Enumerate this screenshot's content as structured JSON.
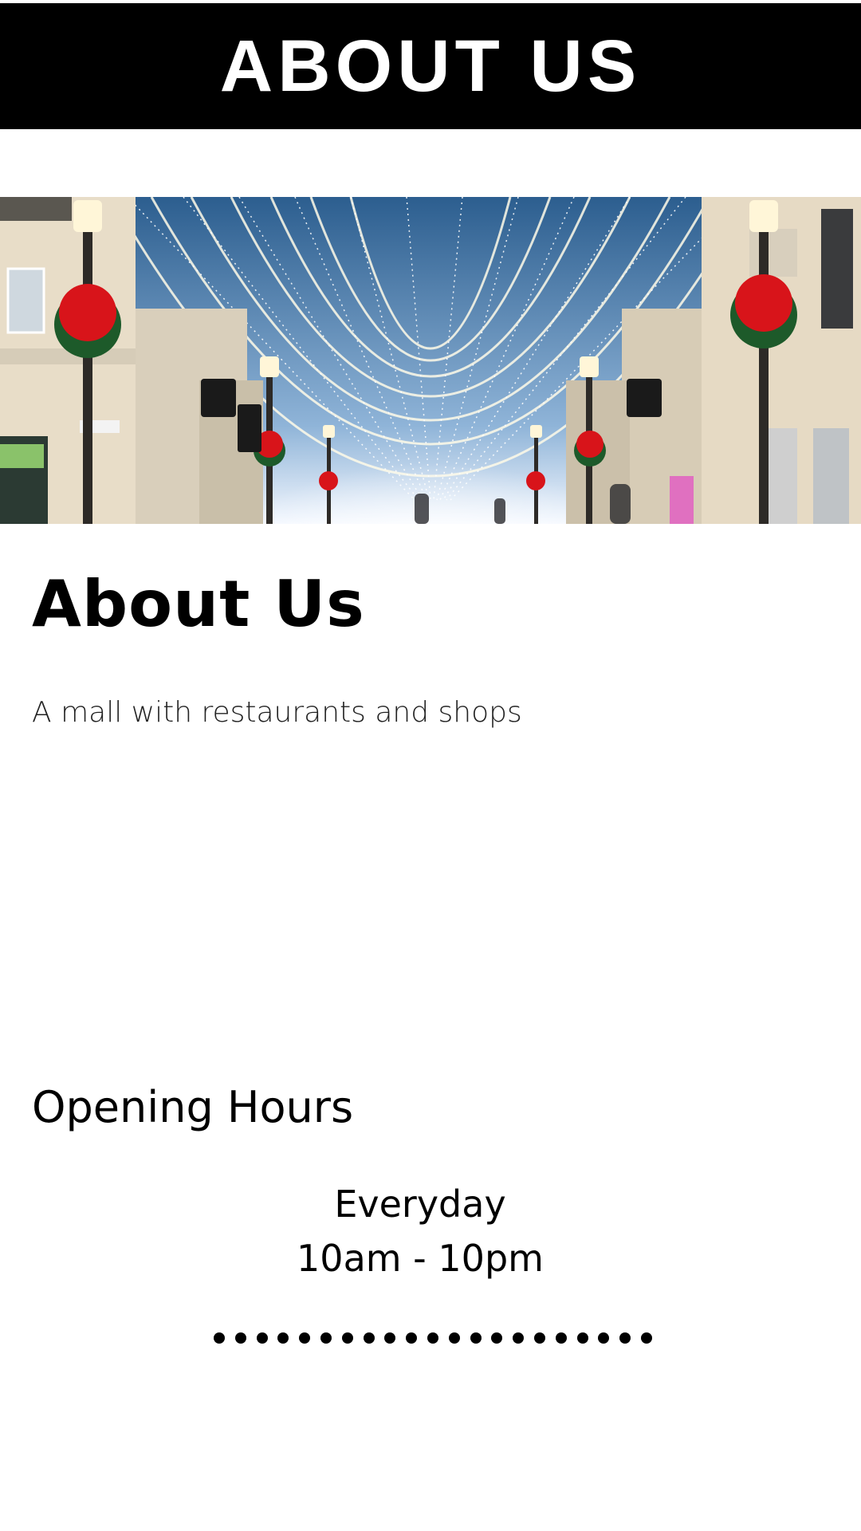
{
  "banner": {
    "title": "ABOUT US"
  },
  "hero": {
    "image": "christmas-lights-street-photo"
  },
  "main": {
    "heading": "About Us",
    "tagline": "A mall with restaurants and shops"
  },
  "hours": {
    "heading": "Opening Hours",
    "days": "Everyday",
    "time": "10am - 10pm"
  },
  "pager": {
    "dot_count": 21
  }
}
